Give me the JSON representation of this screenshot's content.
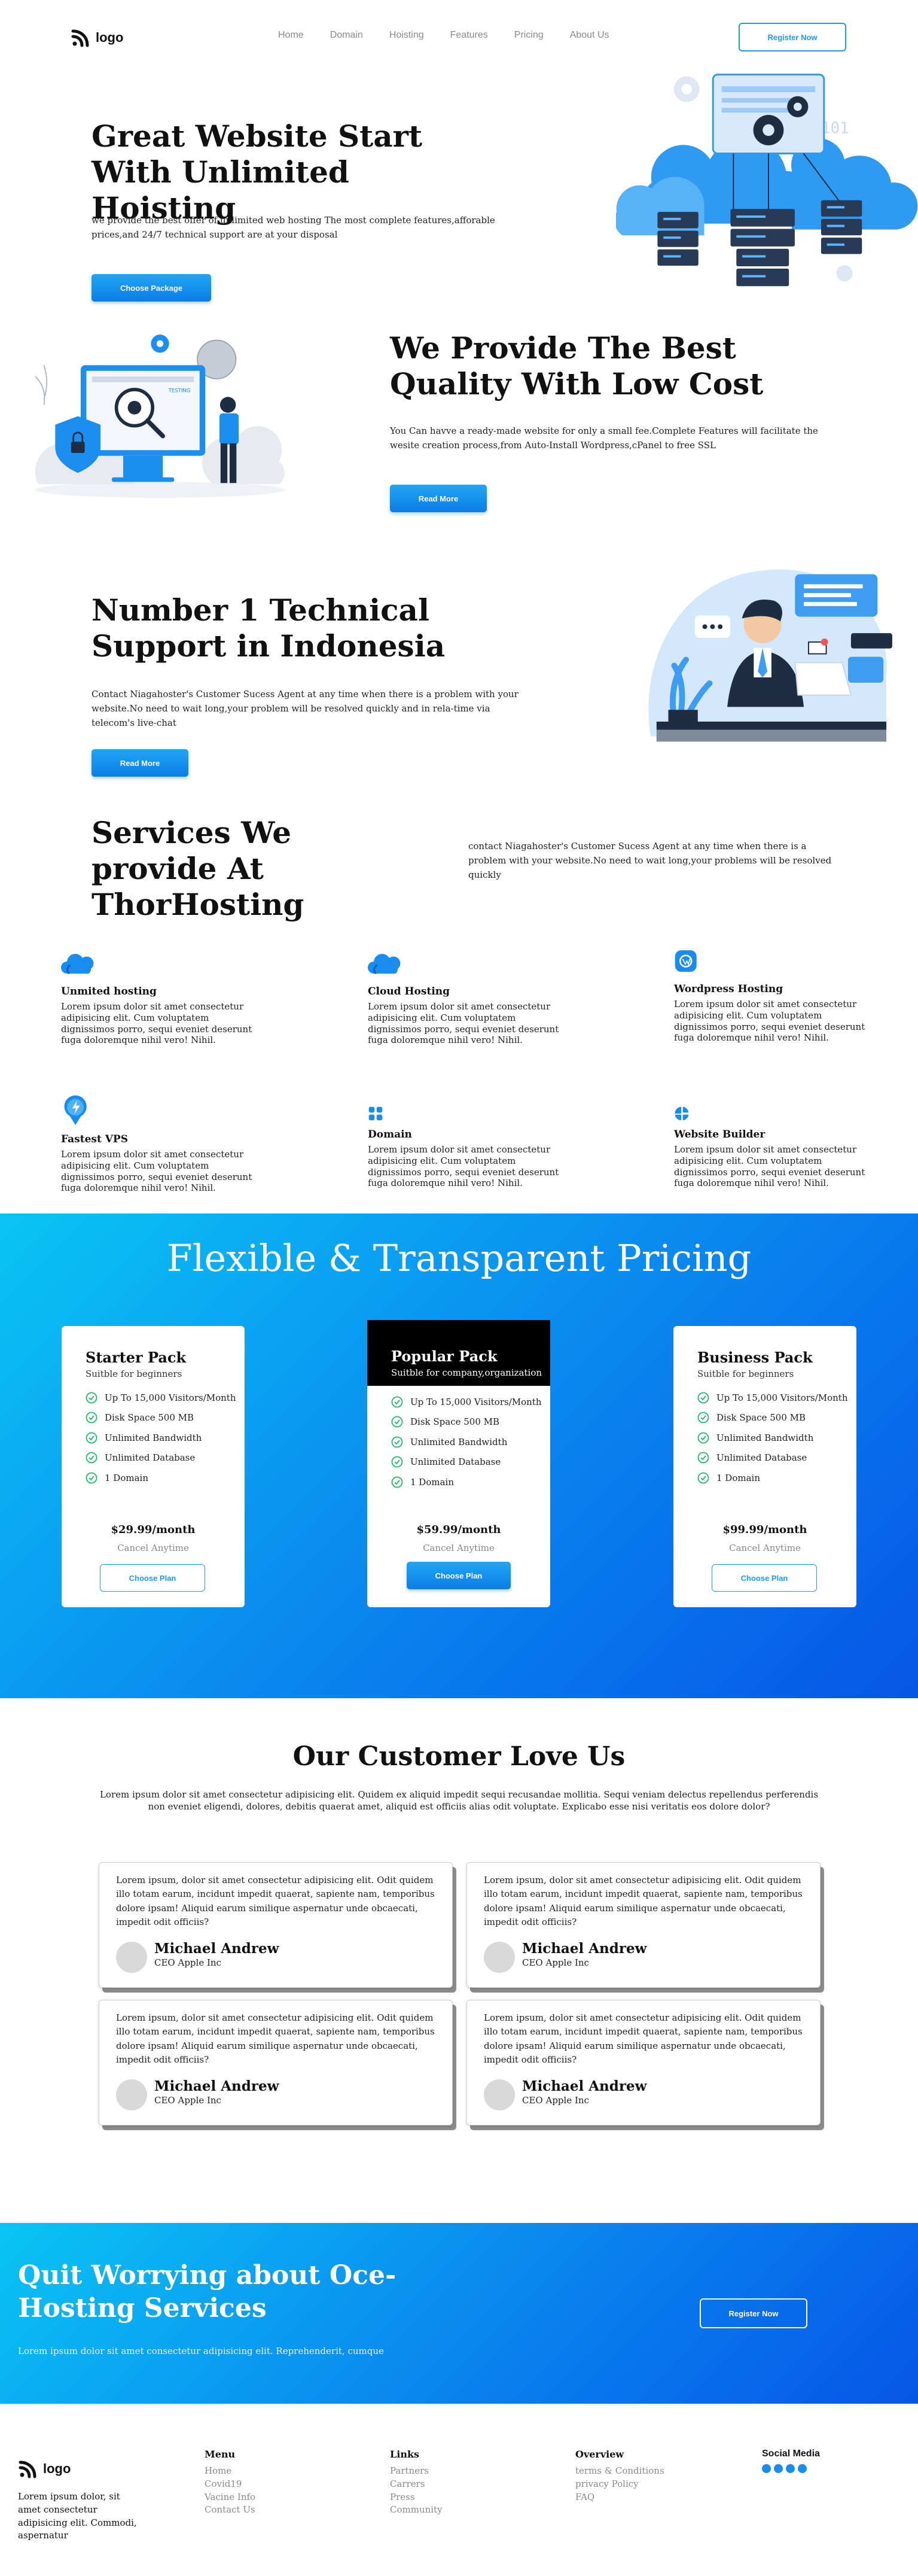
{
  "nav": {
    "logo": "logo",
    "links": [
      "Home",
      "Domain",
      "Hoisting",
      "Features",
      "Pricing",
      "About Us"
    ],
    "register": "Register Now"
  },
  "hero": {
    "title": "Great Website Start With Unlimited Hoisting",
    "text": "we provide the best offer of unlimited web hosting The most complete features,afforable prices,and 24/7 technical support are at your disposal",
    "button": "Choose Package",
    "illustration_text": "0101"
  },
  "quality": {
    "title": "We Provide The Best Quality With Low Cost",
    "text": "You Can havve a ready-made website for only a small fee.Complete Features will facilitate the wesite creation process,from Auto-Install Wordpress,cPanel to free SSL",
    "button": "Read More",
    "illustration_text": "TESTING"
  },
  "support": {
    "title": "Number 1 Technical Support in Indonesia",
    "text": "Contact Niagahoster's Customer Sucess Agent at any time when there is a problem with your website.No need to wait long,your problem will be resolved quickly and in rela-time via telecom's live-chat",
    "button": "Read More"
  },
  "services": {
    "title": "Services We provide At ThorHosting",
    "text": "contact Niagahoster's Customer Sucess Agent at any time when there is a problem with your website.No need to wait long,your problems will be resolved quickly",
    "items": [
      {
        "title": "Unmited hosting",
        "text": "Lorem ipsum dolor sit amet consectetur adipisicing elit. Cum voluptatem dignissimos porro, sequi eveniet deserunt fuga doloremque nihil vero! Nihil.",
        "icon": "cloud-icon"
      },
      {
        "title": "Cloud Hosting",
        "text": "Lorem ipsum dolor sit amet consectetur adipisicing elit. Cum voluptatem dignissimos porro, sequi eveniet deserunt fuga doloremque nihil vero! Nihil.",
        "icon": "cloud-icon"
      },
      {
        "title": "Wordpress Hosting",
        "text": "Lorem ipsum dolor sit amet consectetur adipisicing elit. Cum voluptatem dignissimos porro, sequi eveniet deserunt fuga doloremque nihil vero! Nihil.",
        "icon": "wordpress-icon"
      },
      {
        "title": "Fastest VPS",
        "text": "Lorem ipsum dolor sit amet consectetur adipisicing elit. Cum voluptatem dignissimos porro, sequi eveniet deserunt fuga doloremque nihil vero! Nihil.",
        "icon": "lightning-pin-icon"
      },
      {
        "title": "Domain",
        "text": "Lorem ipsum dolor sit amet consectetur adipisicing elit. Cum voluptatem dignissimos porro, sequi eveniet deserunt fuga doloremque nihil vero! Nihil.",
        "icon": "grid-icon"
      },
      {
        "title": "Website Builder",
        "text": "Lorem ipsum dolor sit amet consectetur adipisicing elit. Cum voluptatem dignissimos porro, sequi eveniet deserunt fuga doloremque nihil vero! Nihil.",
        "icon": "pie-chart-icon"
      }
    ]
  },
  "pricing": {
    "title": "Flexible & Transparent Pricing",
    "plans": [
      {
        "name": "Starter Pack",
        "sub": "Suitble for beginners",
        "features": [
          "Up To 15,000 Visitors/Month",
          "Disk Space 500 MB",
          "Unlimited Bandwidth",
          "Unlimited Database",
          "1 Domain"
        ],
        "price": "$29.99/month",
        "cancel": "Cancel Anytime",
        "button": "Choose Plan"
      },
      {
        "name": "Popular Pack",
        "sub": "Suitble for company,organization",
        "features": [
          "Up To 15,000 Visitors/Month",
          "Disk Space 500 MB",
          "Unlimited Bandwidth",
          "Unlimited Database",
          "1 Domain"
        ],
        "price": "$59.99/month",
        "cancel": "Cancel Anytime",
        "button": "Choose Plan"
      },
      {
        "name": "Business Pack",
        "sub": "Suitble for beginners",
        "features": [
          "Up To 15,000 Visitors/Month",
          "Disk Space 500 MB",
          "Unlimited Bandwidth",
          "Unlimited Database",
          "1 Domain"
        ],
        "price": "$99.99/month",
        "cancel": "Cancel Anytime",
        "button": "Choose Plan"
      }
    ]
  },
  "testimonials": {
    "title": "Our Customer Love Us",
    "intro": "Lorem ipsum dolor sit amet consectetur adipisicing elit. Quidem ex aliquid impedit sequi recusandae mollitia. Sequi veniam delectus repellendus perferendis non eveniet eligendi, dolores, debitis quaerat amet, aliquid est officiis alias odit voluptate. Explicabo esse nisi veritatis eos dolore dolor?",
    "items": [
      {
        "text": "Lorem ipsum, dolor sit amet consectetur adipisicing elit. Odit quidem illo totam earum, incidunt impedit quaerat, sapiente nam, temporibus dolore ipsam! Aliquid earum similique aspernatur unde obcaecati, impedit odit officiis?",
        "name": "Michael Andrew",
        "role": "CEO Apple Inc"
      },
      {
        "text": "Lorem ipsum, dolor sit amet consectetur adipisicing elit. Odit quidem illo totam earum, incidunt impedit quaerat, sapiente nam, temporibus dolore ipsam! Aliquid earum similique aspernatur unde obcaecati, impedit odit officiis?",
        "name": "Michael Andrew",
        "role": "CEO Apple Inc"
      },
      {
        "text": "Lorem ipsum, dolor sit amet consectetur adipisicing elit. Odit quidem illo totam earum, incidunt impedit quaerat, sapiente nam, temporibus dolore ipsam! Aliquid earum similique aspernatur unde obcaecati, impedit odit officiis?",
        "name": "Michael Andrew",
        "role": "CEO Apple Inc"
      },
      {
        "text": "Lorem ipsum, dolor sit amet consectetur adipisicing elit. Odit quidem illo totam earum, incidunt impedit quaerat, sapiente nam, temporibus dolore ipsam! Aliquid earum similique aspernatur unde obcaecati, impedit odit officiis?",
        "name": "Michael Andrew",
        "role": "CEO Apple Inc"
      }
    ]
  },
  "cta": {
    "title": "Quit Worrying about Oce-Hosting Services",
    "text": "Lorem ipsum dolor sit amet consectetur adipisicing elit. Reprehenderit, cumque",
    "button": "Register Now"
  },
  "footer": {
    "logo": "logo",
    "about": "Lorem ipsum dolor, sit amet consectetur adipisicing elit. Commodi, aspernatur",
    "menu": {
      "title": "Menu",
      "links": [
        "Home",
        "Covid19",
        "Vacine Info",
        "Contact Us"
      ]
    },
    "links": {
      "title": "Links",
      "links": [
        "Partners",
        "Carrers",
        "Press",
        "Community"
      ]
    },
    "overview": {
      "title": "Overview",
      "links": [
        "terms & Conditions",
        "privacy Policy",
        "FAQ"
      ]
    },
    "social": {
      "title": "Social Media"
    }
  },
  "colors": {
    "primary": "#1c9bf0",
    "gradient_start": "#0ac4f4",
    "gradient_end": "#0656e6",
    "popular_header": "#000000"
  }
}
